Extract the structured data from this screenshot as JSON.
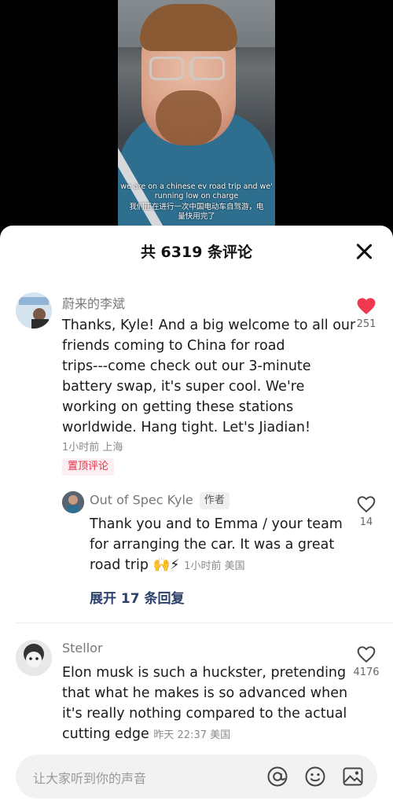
{
  "video": {
    "caption_en_1": "we are on a chinese ev road trip and we'",
    "caption_en_2": "running low on charge",
    "caption_zh_1": "我们正在进行一次中国电动车自驾游，电",
    "caption_zh_2": "量快用完了"
  },
  "comments_panel": {
    "title": "共 6319 条评论",
    "comments": [
      {
        "user": "蔚来的李斌",
        "text": [
          "Thanks, Kyle! And a big welcome to all our",
          "friends coming to China for road",
          "trips---come check out our 3-minute",
          "battery swap, it's super cool. We're",
          "working on getting these stations",
          "worldwide. Hang tight. Let's Jiadian!"
        ],
        "meta": "1小时前 上海",
        "likes": "251",
        "liked": true,
        "pinned_label": "置顶评论"
      },
      {
        "user": "Out of Spec Kyle",
        "author_tag": "作者",
        "text": [
          "Thank you and to Emma / your team",
          "for arranging the car. It was a great",
          "road trip 🙌⚡"
        ],
        "meta": "1小时前 美国",
        "likes": "14",
        "liked": false
      },
      {
        "user": "Stellor",
        "text": [
          "Elon musk is such a huckster, pretending",
          "that what he makes is so advanced when",
          "it's really nothing compared to the actual",
          "cutting edge"
        ],
        "meta": "昨天 22:37 美国",
        "likes": "4176",
        "liked": false
      }
    ],
    "expand_replies": "展开 17 条回复"
  },
  "input": {
    "placeholder": "让大家听到你的声音",
    "icons": [
      "at-icon",
      "emoji-icon",
      "image-icon"
    ]
  },
  "colors": {
    "heart_red": "#f2384e",
    "pin_red": "#e0334a",
    "expand_blue": "#2a3f6a"
  }
}
